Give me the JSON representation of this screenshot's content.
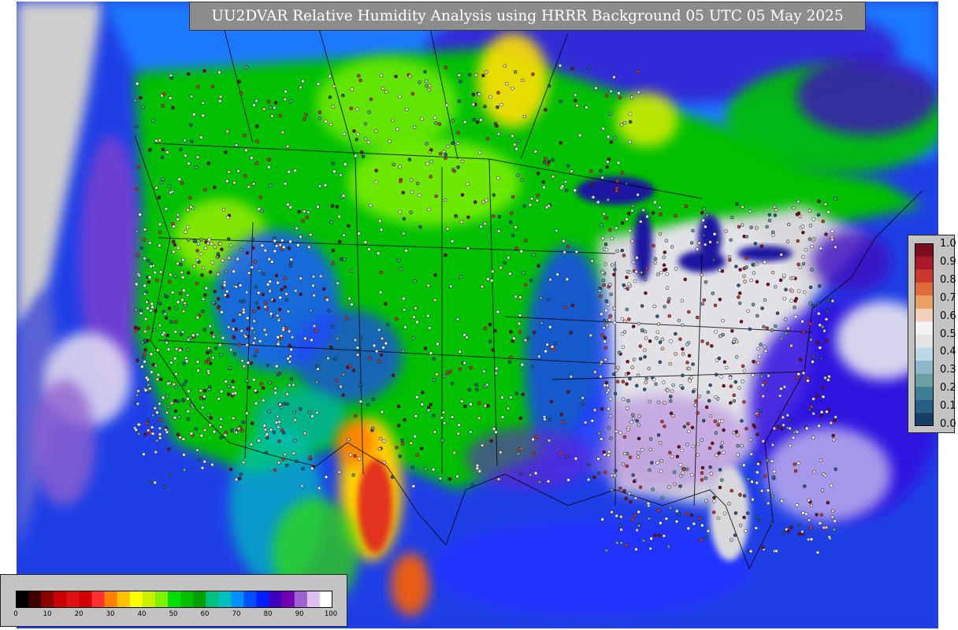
{
  "title": "UU2DVAR Relative Humidity Analysis using HRRR Background 05 UTC 05 May 2025",
  "obs_legend": {
    "labels": [
      "1.0",
      "0.9",
      "0.8",
      "0.7",
      "0.6",
      "0.5",
      "0.4",
      "0.3",
      "0.2",
      "0.1",
      "0.0"
    ],
    "colors": [
      "#7a0e1e",
      "#a8192b",
      "#c9372e",
      "#de6a3d",
      "#e9a062",
      "#f5d0b8",
      "#f2f2f2",
      "#e3e3e3",
      "#bcd7e8",
      "#8fb8cc",
      "#6aa0a3",
      "#3e7f93",
      "#265f86",
      "#153f66"
    ]
  },
  "rh_colorbar": {
    "labels": [
      "0",
      "10",
      "20",
      "30",
      "40",
      "50",
      "60",
      "70",
      "80",
      "90",
      "100"
    ],
    "colors": [
      "#000000",
      "#3c0000",
      "#8b0000",
      "#cc0000",
      "#e01010",
      "#d40000",
      "#ff3030",
      "#ff8000",
      "#ffc000",
      "#ffff00",
      "#c8f000",
      "#80f000",
      "#00e000",
      "#00c000",
      "#00a000",
      "#00c080",
      "#00c0c0",
      "#0090ff",
      "#0050ff",
      "#0020ff",
      "#4000c0",
      "#7000b0",
      "#a060d0",
      "#e0c0f0",
      "#ffffff"
    ]
  },
  "colors": {
    "background_panel": "#c3c3c3",
    "title_bg": "#8c8c8c",
    "ocean_blue": "#1f3fe6",
    "land_green": "#00c000",
    "dry_red": "#e02020",
    "dry_yellow": "#ffd000",
    "humid_gray": "#d8d8dc",
    "purple": "#7a19c8"
  }
}
